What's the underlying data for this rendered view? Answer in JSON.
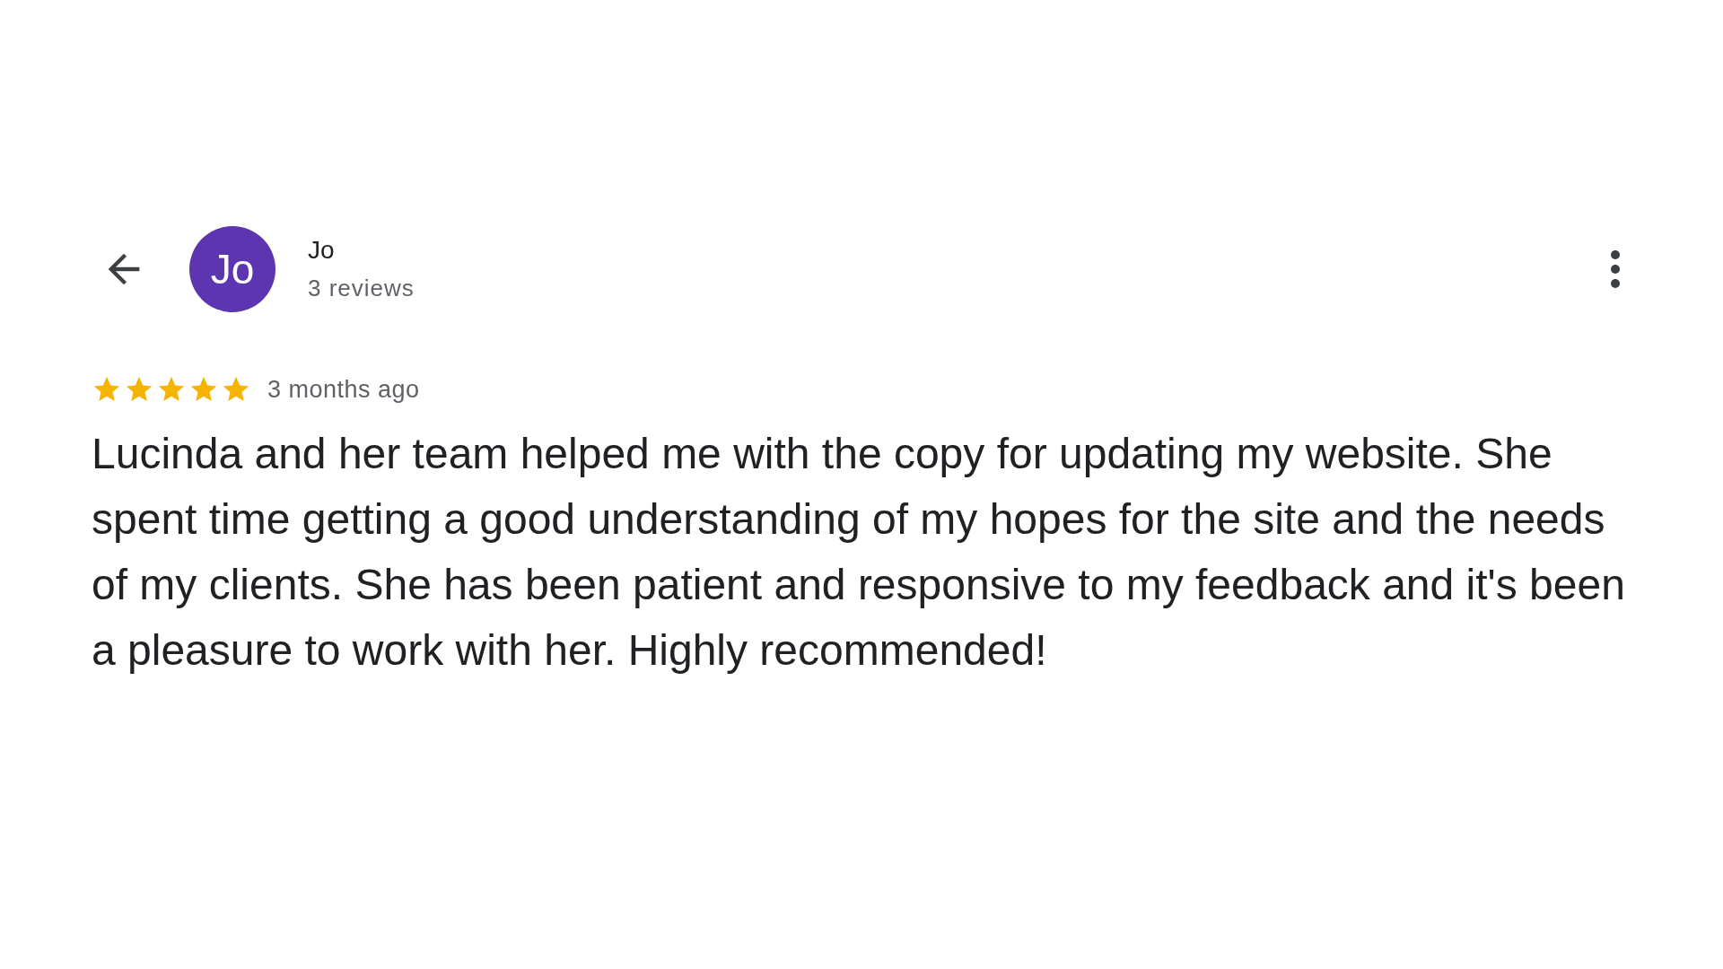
{
  "header": {
    "avatar_initials": "Jo",
    "name": "Jo",
    "reviews_count": "3 reviews"
  },
  "review": {
    "stars": 5,
    "time": "3 months ago",
    "text": "Lucinda and her team helped me with the copy for updating my website. She spent time getting a good understanding of my hopes for the site and the needs of my clients. She has been patient and responsive to my feedback and it's been a pleasure to work with her. Highly recommended!"
  }
}
